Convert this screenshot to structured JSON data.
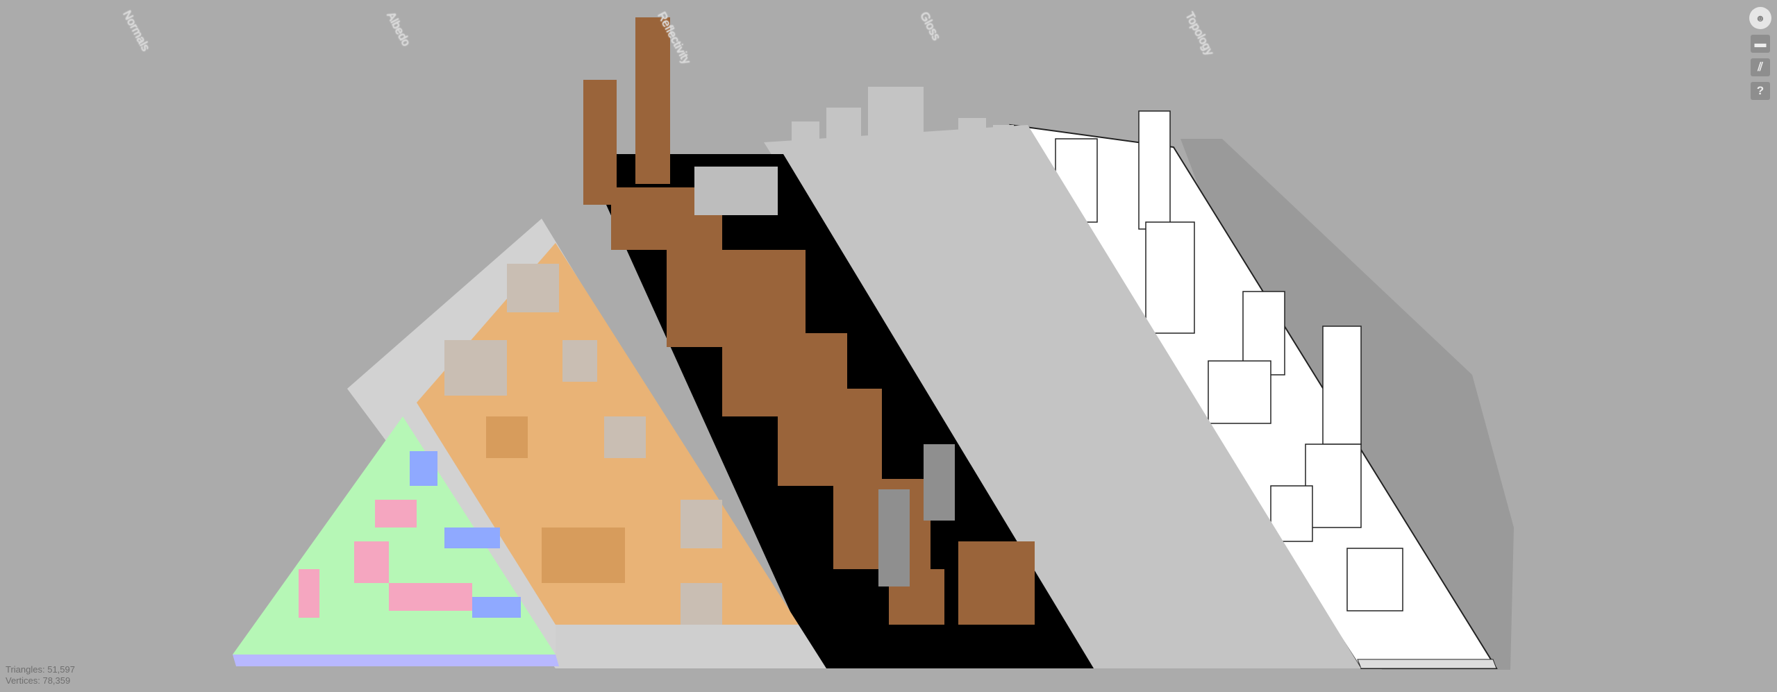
{
  "passes": [
    "Normals",
    "Albedo",
    "Reflectivity",
    "Gloss",
    "Topology"
  ],
  "stats": {
    "triangles": "Triangles: 51,597",
    "vertices": "Vertices: 78,359"
  },
  "toolbar": {
    "items": [
      {
        "icon": "avatar-icon",
        "glyph": "☻"
      },
      {
        "icon": "fullscreen-icon",
        "glyph": "▬"
      },
      {
        "icon": "wireframe-icon",
        "glyph": "⫽"
      },
      {
        "icon": "help-icon",
        "glyph": "?"
      }
    ]
  },
  "colors": {
    "background": "#ababab",
    "normals": "#b6f7b6",
    "albedo": "#e9b376",
    "reflectivity": "#000000",
    "gloss": "#c4c4c4",
    "topology": "#ffffff"
  }
}
